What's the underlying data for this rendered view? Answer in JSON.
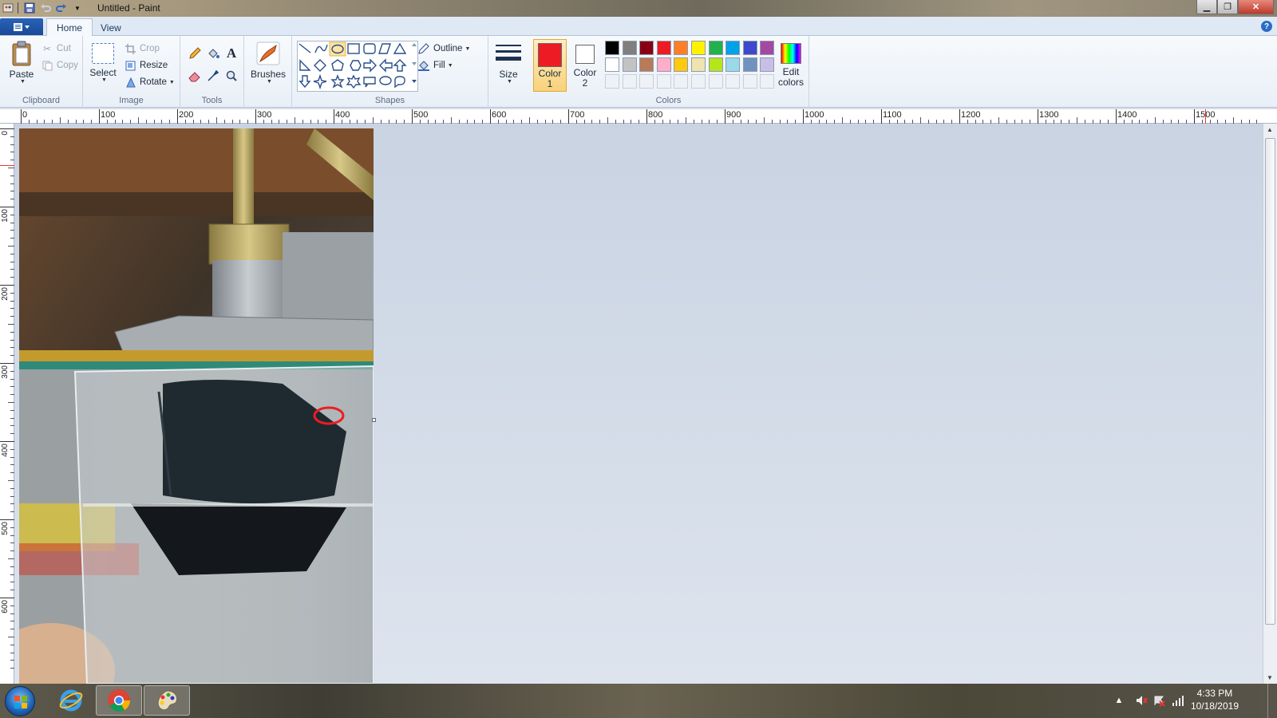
{
  "window": {
    "title": "Untitled - Paint"
  },
  "tabs": {
    "home": "Home",
    "view": "View"
  },
  "clipboard": {
    "group": "Clipboard",
    "paste": "Paste",
    "cut": "Cut",
    "copy": "Copy"
  },
  "image": {
    "group": "Image",
    "select": "Select",
    "crop": "Crop",
    "resize": "Resize",
    "rotate": "Rotate"
  },
  "tools": {
    "group": "Tools"
  },
  "brushes": {
    "label": "Brushes"
  },
  "shapes": {
    "group": "Shapes",
    "outline": "Outline",
    "fill": "Fill"
  },
  "size": {
    "label": "Size"
  },
  "colors": {
    "group": "Colors",
    "color1_line1": "Color",
    "color1_line2": "1",
    "color2_line1": "Color",
    "color2_line2": "2",
    "edit_line1": "Edit",
    "edit_line2": "colors",
    "color1_value": "#ed1c24",
    "color2_value": "#ffffff",
    "palette_row1": [
      "#000000",
      "#7f7f7f",
      "#880015",
      "#ed1c24",
      "#ff7f27",
      "#fff200",
      "#22b14c",
      "#00a2e8",
      "#3f48cc",
      "#a349a4"
    ],
    "palette_row2": [
      "#ffffff",
      "#c3c3c3",
      "#b97a57",
      "#ffaec9",
      "#ffc90e",
      "#efe4b0",
      "#b5e61d",
      "#99d9ea",
      "#7092be",
      "#c8bfe7"
    ]
  },
  "ruler": {
    "h_labels": [
      "0",
      "100",
      "200",
      "300",
      "400",
      "500",
      "600",
      "700",
      "800",
      "900",
      "1000",
      "1100",
      "1200",
      "1300",
      "1400",
      "1500"
    ],
    "v_labels": [
      "0",
      "100",
      "200",
      "300",
      "400",
      "500",
      "600"
    ]
  },
  "taskbar": {
    "time": "4:33 PM",
    "date": "10/18/2019"
  }
}
